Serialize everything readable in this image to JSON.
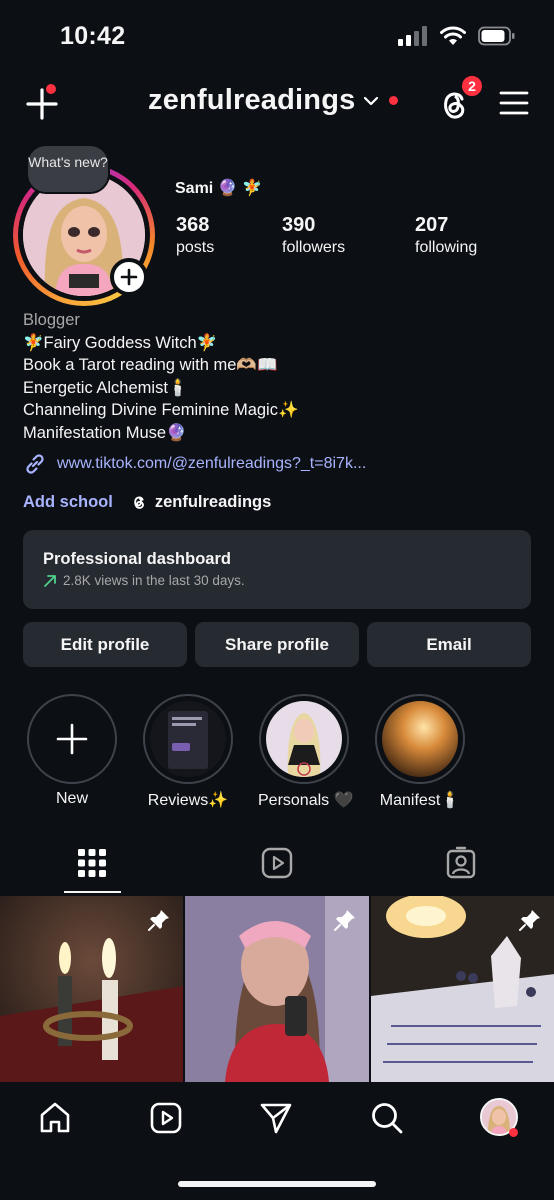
{
  "status_bar": {
    "time": "10:42"
  },
  "header": {
    "username": "zenfulreadings",
    "threads_badge": "2"
  },
  "profile": {
    "note": "What's new?",
    "name": "Sami 🔮 🧚",
    "stats": [
      {
        "value": "368",
        "label": "posts"
      },
      {
        "value": "390",
        "label": "followers"
      },
      {
        "value": "207",
        "label": "following"
      }
    ],
    "bio": {
      "category": "Blogger",
      "lines": [
        "🧚Fairy Goddess Witch🧚",
        "Book a Tarot reading with me🫶🏼📖",
        "Energetic Alchemist🕯️",
        "Channeling Divine Feminine Magic✨",
        "Manifestation Muse🔮"
      ],
      "link": "www.tiktok.com/@zenfulreadings?_t=8i7k...",
      "add_school": "Add school",
      "threads_handle": "zenfulreadings"
    }
  },
  "dashboard": {
    "title": "Professional dashboard",
    "subtitle": "2.8K views in the last 30 days."
  },
  "buttons": {
    "edit": "Edit profile",
    "share": "Share profile",
    "email": "Email"
  },
  "highlights": [
    {
      "label": "New"
    },
    {
      "label": "Reviews✨"
    },
    {
      "label": "Personals 🖤"
    },
    {
      "label": "Manifest🕯️"
    }
  ],
  "tabs": [
    "grid-icon",
    "reels-icon",
    "tagged-icon"
  ],
  "colors": {
    "background": "#0c0f14",
    "surface": "#262a31",
    "link": "#a8b4ff",
    "notification": "#ff3040"
  }
}
